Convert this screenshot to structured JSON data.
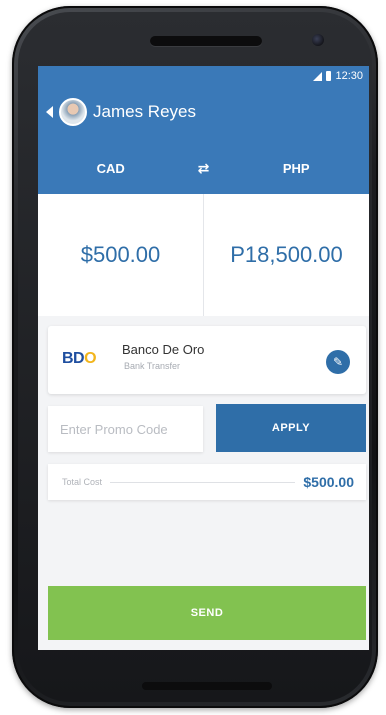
{
  "status_bar": {
    "time": "12:30"
  },
  "header": {
    "recipient_name": "James Reyes",
    "from_currency": "CAD",
    "to_currency": "PHP",
    "swap_icon": "swap-arrows-icon"
  },
  "amounts": {
    "send_amount": "$500.00",
    "receive_amount": "P18,500.00"
  },
  "bank": {
    "logo_text_b_d": "BD",
    "logo_text_o": "O",
    "name": "Banco De Oro",
    "type": "Bank Transfer",
    "edit_icon": "pencil-icon"
  },
  "promo": {
    "placeholder": "Enter Promo Code",
    "apply_label": "APPLY"
  },
  "total": {
    "label": "Total Cost",
    "value": "$500.00"
  },
  "send_label": "SEND",
  "colors": {
    "primary": "#3a79b8",
    "accent_text": "#2f6ea8",
    "send_green": "#82c250",
    "background": "#f3f4f6"
  }
}
